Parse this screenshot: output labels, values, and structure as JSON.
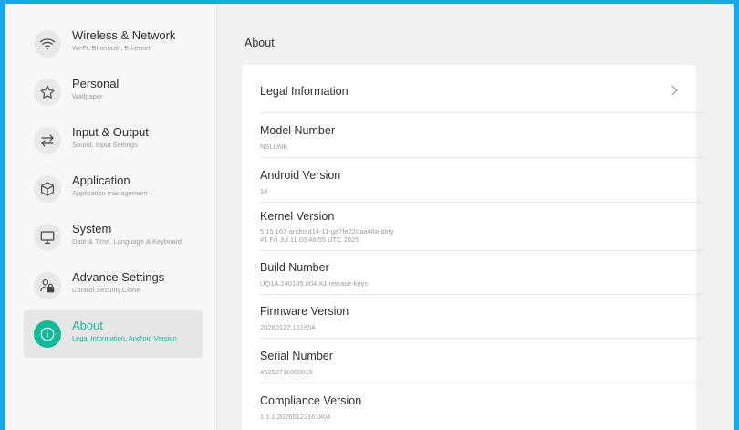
{
  "sidebar": {
    "items": [
      {
        "title": "Wireless & Network",
        "subtitle": "Wi-Fi, Bluetooth, Ethernet",
        "icon": "wifi-icon"
      },
      {
        "title": "Personal",
        "subtitle": "Wallpaper",
        "icon": "star-icon"
      },
      {
        "title": "Input & Output",
        "subtitle": "Sound, Input Settings",
        "icon": "swap-arrows-icon"
      },
      {
        "title": "Application",
        "subtitle": "Application management",
        "icon": "cube-icon"
      },
      {
        "title": "System",
        "subtitle": "Date & Time, Language & Keyboard",
        "icon": "monitor-icon"
      },
      {
        "title": "Advance Settings",
        "subtitle": "Control,Security,Clone",
        "icon": "user-lock-icon"
      },
      {
        "title": "About",
        "subtitle": "Legal Information, Android Version",
        "icon": "info-icon",
        "active": true
      }
    ]
  },
  "main": {
    "title": "About",
    "legal": {
      "title": "Legal Information"
    },
    "model": {
      "title": "Model Number",
      "value": "NSLUNK"
    },
    "android": {
      "title": "Android Version",
      "value": "14"
    },
    "kernel": {
      "title": "Kernel Version",
      "value_line1": "5.15.167-android14-11-ga7fe22daa48a-dirty",
      "value_line2": "#1 Fri Jul 11 03:46:55 UTC 2025"
    },
    "build": {
      "title": "Build Number",
      "value": "UQ1A.240105.004.A1 release-keys"
    },
    "firmware": {
      "title": "Firmware Version",
      "value": "20260122.161804"
    },
    "serial": {
      "title": "Serial Number",
      "value": "45250711000015"
    },
    "compliance": {
      "title": "Compliance Version",
      "value": "1.1.1.20260122161804"
    }
  },
  "colors": {
    "accent": "#14b99a",
    "border": "#1aa7e6"
  }
}
